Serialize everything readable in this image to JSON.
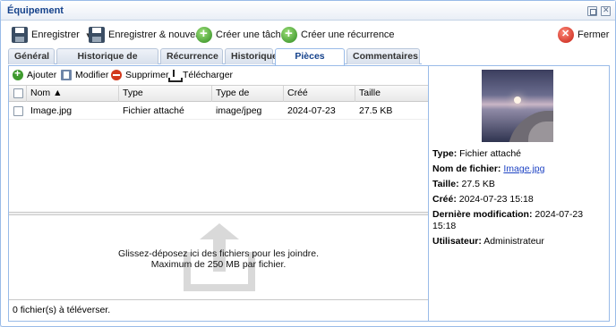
{
  "window": {
    "title": "Équipement"
  },
  "toolbar": {
    "save": "Enregistrer",
    "save_new": "Enregistrer & nouveau",
    "create_task": "Créer une tâche",
    "create_recurrence": "Créer une récurrence",
    "close": "Fermer"
  },
  "tabs": [
    "Général",
    "Historique de tâches",
    "Récurrence",
    "Historique",
    "Pièces jointes",
    "Commentaires"
  ],
  "active_tab": "Pièces jointes",
  "grid_toolbar": {
    "add": "Ajouter",
    "edit": "Modifier",
    "delete": "Supprimer",
    "download": "Télécharger"
  },
  "columns": [
    "Nom ▲",
    "Type",
    "Type de contenu",
    "Créé",
    "Taille"
  ],
  "rows": [
    {
      "name": "Image.jpg",
      "type": "Fichier attaché",
      "content_type": "image/jpeg",
      "created": "2024-07-23",
      "size": "27.5 KB"
    }
  ],
  "dropzone": {
    "line1": "Glissez-déposez ici des fichiers pour les joindre.",
    "line2": "Maximum de 250 MB par fichier."
  },
  "status": "0 fichier(s) à téléverser.",
  "details": {
    "type_label": "Type:",
    "type_value": "Fichier attaché",
    "name_label": "Nom de fichier:",
    "name_value": "Image.jpg",
    "size_label": "Taille:",
    "size_value": "27.5 KB",
    "created_label": "Créé:",
    "created_value": "2024-07-23 15:18",
    "modified_label": "Dernière modification:",
    "modified_value": "2024-07-23 15:18",
    "user_label": "Utilisateur:",
    "user_value": "Administrateur"
  },
  "colors": {
    "accent": "#15428b",
    "border": "#99bbe8",
    "link": "#1f44c4"
  }
}
